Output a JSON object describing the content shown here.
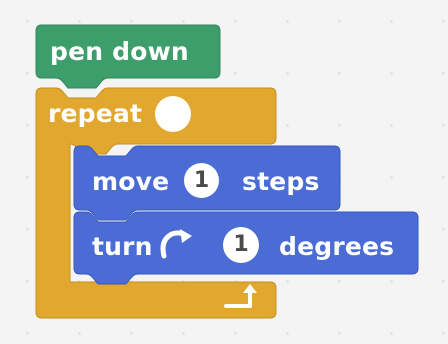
{
  "colors": {
    "workspace_bg": "#f4f4f4",
    "pen_block": "#3e9e6b",
    "control_block": "#e1a72e",
    "motion_block": "#4a6cd4",
    "input_bg": "#ffffff",
    "input_text": "#4a4a4a"
  },
  "blocks": {
    "pen_down": {
      "label": "pen down"
    },
    "repeat": {
      "label": "repeat",
      "count_value": ""
    },
    "move": {
      "label_prefix": "move",
      "steps_value": "1",
      "label_suffix": "steps"
    },
    "turn": {
      "label_prefix": "turn",
      "icon": "rotate-clockwise-icon",
      "degrees_value": "1",
      "label_suffix": "degrees"
    },
    "repeat_end": {
      "icon": "loop-arrow-icon"
    }
  }
}
